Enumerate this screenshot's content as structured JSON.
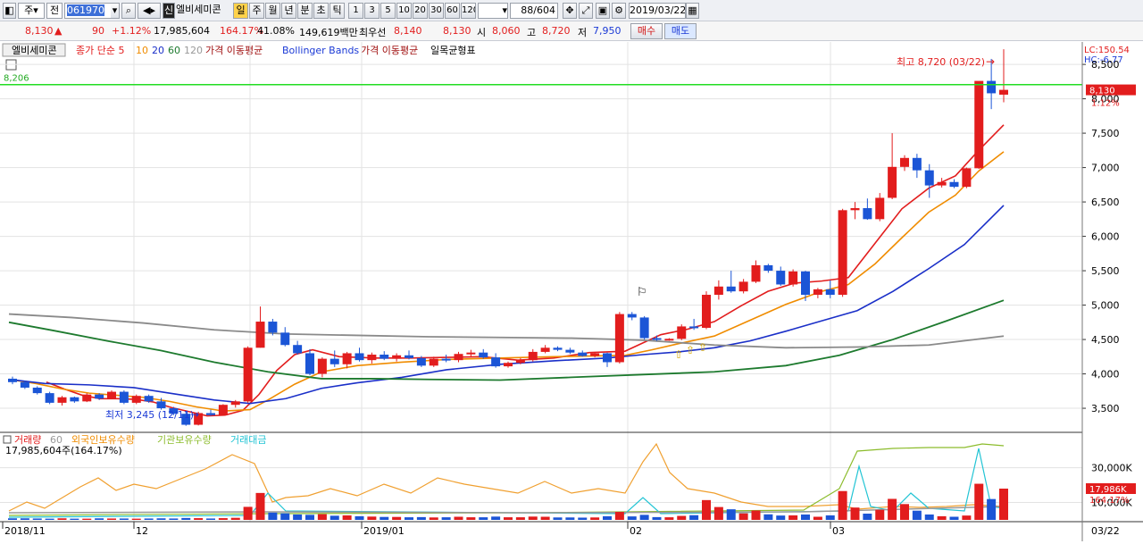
{
  "toolbar": {
    "market": "주",
    "view": "전",
    "code": "061970",
    "search_icon": "search-icon",
    "sound_icon": "speaker-icon",
    "credit_badge": "신",
    "stock_name": "엘비세미콘",
    "period_tabs": [
      "일",
      "주",
      "월",
      "년",
      "분",
      "초",
      "틱"
    ],
    "active_period": "일",
    "intervals": [
      "1",
      "3",
      "5",
      "10",
      "20",
      "30",
      "60",
      "120"
    ],
    "range": "88",
    "range_total": "/604",
    "date": "2019/03/22"
  },
  "info": {
    "price": "8,130",
    "change_arrow": "▲",
    "change": "90",
    "change_pct": "+1.12%",
    "volume": "17,985,604",
    "vol_ratio": "164.17%",
    "turnover": "41.08%",
    "amount": "149,619백만",
    "best_ask_label": "최우선",
    "best_ask": "8,140",
    "best_bid": "8,130",
    "open_label": "시",
    "open": "8,060",
    "high_label": "고",
    "high": "8,720",
    "low_label": "저",
    "low": "7,950",
    "buy_button": "매수",
    "sell_button": "매도"
  },
  "legend": {
    "stock": "엘비세미콘",
    "ma_label": "종가 단순 5",
    "ma10": "10",
    "ma20": "20",
    "ma60": "60",
    "ma120": "120",
    "ind1": "가격 이동평균",
    "ind2": "Bollinger Bands",
    "ind3": "가격 이동평균",
    "ind4": "일목균형표",
    "lc": "LC:150.54",
    "hc": "HC:-6.77"
  },
  "price_axis": {
    "ticks": [
      "8,500",
      "8,000",
      "7,500",
      "7,000",
      "6,500",
      "6,000",
      "5,500",
      "5,000",
      "4,500",
      "4,000",
      "3,500"
    ],
    "current": "8,130",
    "current_pct": "1.12%"
  },
  "annotations": {
    "green_line": "8,206",
    "high": "최고 8,720 (03/22)",
    "low": "최저 3,245 (12/11)"
  },
  "volume_legend": {
    "vol": "거래량",
    "vol_ma": "60",
    "foreign": "외국인보유수량",
    "inst": "기관보유수량",
    "amount": "거래대금",
    "sub": "17,985,604주(164.17%)",
    "axis": [
      "30,000K",
      "10,000K"
    ],
    "current": "17,986K",
    "current_pct": "164.17%"
  },
  "date_axis": [
    "2018/11",
    "12",
    "2019/01",
    "02",
    "03"
  ],
  "date_end": "03/22",
  "colors": {
    "up": "#e21d1d",
    "down": "#1b55d6",
    "ma5": "#e21d1d",
    "ma10": "#f08c00",
    "ma20": "#1a2fc8",
    "ma60": "#1d7a2e",
    "ma120": "#8a8a8a",
    "hline": "#22dd22"
  },
  "chart_data": {
    "type": "candlestick",
    "title": "",
    "ylim": [
      3150,
      8800
    ],
    "candles": [
      [
        3930,
        3960,
        3850,
        3880
      ],
      [
        3880,
        3900,
        3780,
        3800
      ],
      [
        3800,
        3820,
        3700,
        3720
      ],
      [
        3720,
        3740,
        3560,
        3580
      ],
      [
        3580,
        3680,
        3540,
        3660
      ],
      [
        3660,
        3670,
        3580,
        3600
      ],
      [
        3600,
        3720,
        3590,
        3700
      ],
      [
        3700,
        3720,
        3620,
        3640
      ],
      [
        3640,
        3760,
        3630,
        3740
      ],
      [
        3740,
        3760,
        3560,
        3580
      ],
      [
        3580,
        3700,
        3560,
        3680
      ],
      [
        3680,
        3700,
        3580,
        3600
      ],
      [
        3600,
        3650,
        3480,
        3500
      ],
      [
        3500,
        3520,
        3400,
        3420
      ],
      [
        3420,
        3450,
        3245,
        3260
      ],
      [
        3260,
        3450,
        3250,
        3430
      ],
      [
        3430,
        3480,
        3390,
        3400
      ],
      [
        3400,
        3560,
        3390,
        3550
      ],
      [
        3550,
        3620,
        3510,
        3600
      ],
      [
        3600,
        4400,
        3580,
        4380
      ],
      [
        4380,
        4980,
        4380,
        4760
      ],
      [
        4760,
        4800,
        4560,
        4600
      ],
      [
        4600,
        4680,
        4400,
        4420
      ],
      [
        4420,
        4480,
        4280,
        4300
      ],
      [
        4300,
        4360,
        3980,
        4000
      ],
      [
        4000,
        4240,
        3950,
        4220
      ],
      [
        4220,
        4340,
        4100,
        4140
      ],
      [
        4140,
        4320,
        4080,
        4300
      ],
      [
        4300,
        4380,
        4180,
        4200
      ],
      [
        4200,
        4310,
        4150,
        4280
      ],
      [
        4280,
        4330,
        4200,
        4220
      ],
      [
        4220,
        4300,
        4180,
        4270
      ],
      [
        4270,
        4340,
        4210,
        4230
      ],
      [
        4230,
        4260,
        4100,
        4120
      ],
      [
        4120,
        4250,
        4100,
        4220
      ],
      [
        4220,
        4280,
        4170,
        4200
      ],
      [
        4200,
        4320,
        4170,
        4290
      ],
      [
        4290,
        4350,
        4240,
        4310
      ],
      [
        4310,
        4360,
        4220,
        4240
      ],
      [
        4240,
        4300,
        4090,
        4110
      ],
      [
        4110,
        4180,
        4090,
        4160
      ],
      [
        4160,
        4230,
        4140,
        4200
      ],
      [
        4200,
        4360,
        4180,
        4320
      ],
      [
        4320,
        4420,
        4300,
        4380
      ],
      [
        4380,
        4400,
        4330,
        4350
      ],
      [
        4350,
        4380,
        4290,
        4310
      ],
      [
        4310,
        4340,
        4250,
        4260
      ],
      [
        4260,
        4320,
        4240,
        4300
      ],
      [
        4300,
        4310,
        4100,
        4170
      ],
      [
        4170,
        4900,
        4150,
        4870
      ],
      [
        4870,
        4900,
        4780,
        4820
      ],
      [
        4820,
        4840,
        4500,
        4520
      ],
      [
        4520,
        4560,
        4480,
        4500
      ],
      [
        4500,
        4520,
        4480,
        4510
      ],
      [
        4510,
        4720,
        4490,
        4690
      ],
      [
        4690,
        4800,
        4640,
        4670
      ],
      [
        4670,
        5200,
        4650,
        5150
      ],
      [
        5150,
        5360,
        5080,
        5270
      ],
      [
        5270,
        5500,
        5180,
        5200
      ],
      [
        5200,
        5380,
        5170,
        5340
      ],
      [
        5340,
        5650,
        5320,
        5580
      ],
      [
        5580,
        5600,
        5470,
        5500
      ],
      [
        5500,
        5560,
        5280,
        5300
      ],
      [
        5300,
        5520,
        5270,
        5490
      ],
      [
        5490,
        5500,
        5060,
        5150
      ],
      [
        5150,
        5250,
        5100,
        5230
      ],
      [
        5230,
        5360,
        5100,
        5150
      ],
      [
        5150,
        6400,
        5120,
        6380
      ],
      [
        6380,
        6500,
        6250,
        6410
      ],
      [
        6410,
        6550,
        6240,
        6250
      ],
      [
        6250,
        6630,
        6220,
        6560
      ],
      [
        6560,
        7500,
        6540,
        7010
      ],
      [
        7010,
        7180,
        6950,
        7140
      ],
      [
        7140,
        7200,
        6850,
        6960
      ],
      [
        6960,
        7050,
        6560,
        6740
      ],
      [
        6740,
        6850,
        6710,
        6790
      ],
      [
        6790,
        6830,
        6700,
        6720
      ],
      [
        6720,
        7000,
        6700,
        6990
      ],
      [
        6990,
        8100,
        6980,
        8260
      ],
      [
        8260,
        8580,
        7850,
        8080
      ],
      [
        8060,
        8720,
        7950,
        8130
      ]
    ],
    "ma_series": [
      {
        "name": "5",
        "values": [
          [
            52,
            3880
          ],
          [
            62,
            3830
          ],
          [
            72,
            3780
          ],
          [
            92,
            3690
          ],
          [
            112,
            3640
          ],
          [
            132,
            3640
          ],
          [
            152,
            3630
          ],
          [
            172,
            3590
          ],
          [
            192,
            3510
          ],
          [
            212,
            3450
          ],
          [
            232,
            3390
          ],
          [
            252,
            3400
          ],
          [
            272,
            3470
          ],
          [
            290,
            3700
          ],
          [
            310,
            4050
          ],
          [
            330,
            4280
          ],
          [
            350,
            4350
          ],
          [
            380,
            4250
          ],
          [
            420,
            4230
          ],
          [
            460,
            4230
          ],
          [
            500,
            4240
          ],
          [
            540,
            4250
          ],
          [
            580,
            4200
          ],
          [
            620,
            4230
          ],
          [
            660,
            4310
          ],
          [
            700,
            4330
          ],
          [
            720,
            4450
          ],
          [
            740,
            4570
          ],
          [
            770,
            4650
          ],
          [
            800,
            4760
          ],
          [
            830,
            4990
          ],
          [
            860,
            5200
          ],
          [
            890,
            5320
          ],
          [
            920,
            5350
          ],
          [
            950,
            5400
          ],
          [
            980,
            5900
          ],
          [
            1010,
            6400
          ],
          [
            1040,
            6700
          ],
          [
            1070,
            6880
          ],
          [
            1096,
            7250
          ],
          [
            1124,
            7620
          ]
        ]
      },
      {
        "name": "10",
        "values": [
          [
            10,
            3920
          ],
          [
            40,
            3860
          ],
          [
            70,
            3780
          ],
          [
            100,
            3720
          ],
          [
            130,
            3690
          ],
          [
            160,
            3660
          ],
          [
            190,
            3600
          ],
          [
            220,
            3520
          ],
          [
            250,
            3460
          ],
          [
            280,
            3480
          ],
          [
            300,
            3620
          ],
          [
            330,
            3850
          ],
          [
            360,
            4030
          ],
          [
            400,
            4120
          ],
          [
            450,
            4170
          ],
          [
            500,
            4210
          ],
          [
            560,
            4230
          ],
          [
            620,
            4250
          ],
          [
            660,
            4260
          ],
          [
            700,
            4270
          ],
          [
            730,
            4350
          ],
          [
            760,
            4440
          ],
          [
            800,
            4550
          ],
          [
            840,
            4780
          ],
          [
            880,
            5010
          ],
          [
            920,
            5200
          ],
          [
            950,
            5300
          ],
          [
            980,
            5600
          ],
          [
            1010,
            5980
          ],
          [
            1040,
            6350
          ],
          [
            1070,
            6600
          ],
          [
            1096,
            6950
          ],
          [
            1124,
            7230
          ]
        ]
      },
      {
        "name": "20",
        "values": [
          [
            10,
            3920
          ],
          [
            50,
            3860
          ],
          [
            100,
            3840
          ],
          [
            150,
            3800
          ],
          [
            200,
            3700
          ],
          [
            240,
            3620
          ],
          [
            280,
            3570
          ],
          [
            320,
            3640
          ],
          [
            360,
            3790
          ],
          [
            400,
            3870
          ],
          [
            450,
            3950
          ],
          [
            500,
            4060
          ],
          [
            560,
            4140
          ],
          [
            620,
            4190
          ],
          [
            680,
            4230
          ],
          [
            720,
            4280
          ],
          [
            760,
            4320
          ],
          [
            800,
            4380
          ],
          [
            840,
            4480
          ],
          [
            880,
            4620
          ],
          [
            920,
            4770
          ],
          [
            960,
            4920
          ],
          [
            1000,
            5200
          ],
          [
            1040,
            5530
          ],
          [
            1080,
            5880
          ],
          [
            1124,
            6450
          ]
        ]
      },
      {
        "name": "60",
        "values": [
          [
            10,
            4750
          ],
          [
            60,
            4630
          ],
          [
            120,
            4480
          ],
          [
            180,
            4340
          ],
          [
            240,
            4170
          ],
          [
            300,
            4030
          ],
          [
            360,
            3930
          ],
          [
            420,
            3930
          ],
          [
            480,
            3920
          ],
          [
            560,
            3910
          ],
          [
            640,
            3950
          ],
          [
            720,
            3990
          ],
          [
            800,
            4030
          ],
          [
            880,
            4120
          ],
          [
            940,
            4270
          ],
          [
            1000,
            4500
          ],
          [
            1060,
            4770
          ],
          [
            1124,
            5070
          ]
        ]
      },
      {
        "name": "120",
        "values": [
          [
            10,
            4870
          ],
          [
            80,
            4820
          ],
          [
            160,
            4740
          ],
          [
            240,
            4640
          ],
          [
            320,
            4580
          ],
          [
            400,
            4560
          ],
          [
            480,
            4540
          ],
          [
            560,
            4530
          ],
          [
            640,
            4520
          ],
          [
            720,
            4490
          ],
          [
            800,
            4420
          ],
          [
            880,
            4380
          ],
          [
            960,
            4390
          ],
          [
            1040,
            4420
          ],
          [
            1124,
            4550
          ]
        ]
      }
    ],
    "volume": {
      "unit": "K",
      "ylim": [
        0,
        36000
      ],
      "values": [
        900,
        900,
        800,
        700,
        900,
        700,
        700,
        900,
        800,
        800,
        700,
        800,
        900,
        800,
        1100,
        1000,
        800,
        1000,
        1200,
        7500,
        15500,
        4200,
        3800,
        3100,
        2900,
        3300,
        2400,
        2600,
        2100,
        1900,
        1700,
        1700,
        1500,
        1600,
        1400,
        1500,
        1800,
        1500,
        1500,
        1900,
        1500,
        1500,
        1900,
        1800,
        1400,
        1400,
        1300,
        1400,
        2100,
        4600,
        2000,
        2900,
        1600,
        1500,
        2300,
        2700,
        11400,
        7400,
        6100,
        3800,
        5400,
        3200,
        2500,
        2600,
        3100,
        1800,
        2600,
        16600,
        7100,
        3600,
        5800,
        12100,
        9100,
        5300,
        3100,
        2100,
        1800,
        2500,
        20800,
        12000,
        18000
      ]
    }
  }
}
